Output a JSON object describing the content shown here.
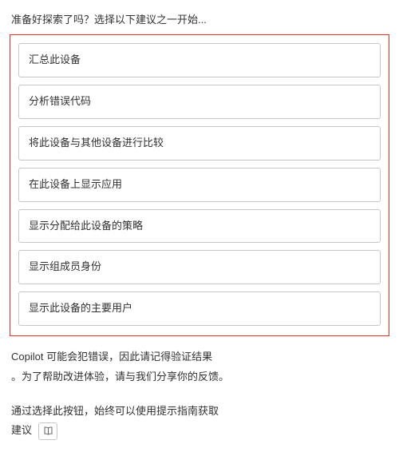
{
  "intro": "准备好探索了吗？选择以下建议之一开始...",
  "suggestions": [
    {
      "label": "汇总此设备"
    },
    {
      "label": "分析错误代码"
    },
    {
      "label": "将此设备与其他设备进行比较"
    },
    {
      "label": "在此设备上显示应用"
    },
    {
      "label": "显示分配给此设备的策略"
    },
    {
      "label": "显示组成员身份"
    },
    {
      "label": "显示此设备的主要用户"
    }
  ],
  "disclaimer": {
    "line1": "Copilot 可能会犯错误，因此请记得验证结果",
    "line2": "。为了帮助改进体验，请与我们分享你的反馈。"
  },
  "guide": {
    "line1": "通过选择此按钮，始终可以使用提示指南获取",
    "line2_label": "建议",
    "icon_name": "book-icon"
  }
}
